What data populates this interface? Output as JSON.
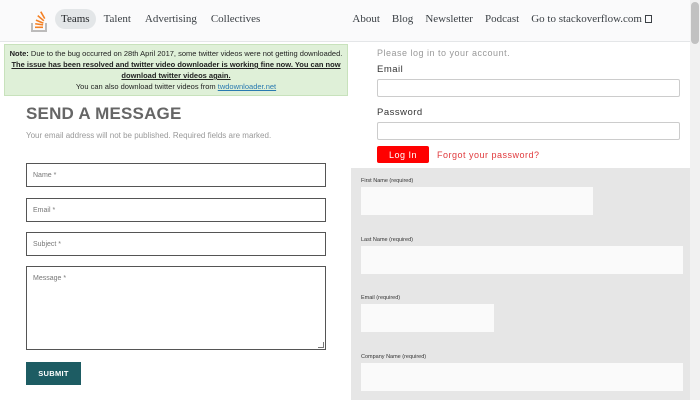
{
  "nav": {
    "left": [
      "Teams",
      "Talent",
      "Advertising",
      "Collectives"
    ],
    "right": [
      "About",
      "Blog",
      "Newsletter",
      "Podcast",
      "Go to stackoverflow.com"
    ]
  },
  "note": {
    "prefix": "Note:",
    "text1": " Due to the bug occurred on 28th April 2017, some twitter videos were not getting downloaded.",
    "text2": "The issue has been resolved and twitter video downloader is working fine now. You can now download twitter videos again.",
    "text3": "You can also download twitter videos from ",
    "link": "twdownloader.net"
  },
  "contact": {
    "title": "SEND A MESSAGE",
    "subtitle": "Your email address will not be published. Required fields are marked.",
    "name_placeholder": "Name *",
    "email_placeholder": "Email *",
    "subject_placeholder": "Subject *",
    "message_placeholder": "Message *",
    "submit": "SUBMIT"
  },
  "login": {
    "hint": "Please log in to your account.",
    "email_label": "Email",
    "password_label": "Password",
    "button": "Log In",
    "forgot": "Forgot your password?"
  },
  "signup": {
    "first_name": "First Name (required)",
    "last_name": "Last Name (required)",
    "email": "Email (required)",
    "company": "Company Name (required)"
  }
}
